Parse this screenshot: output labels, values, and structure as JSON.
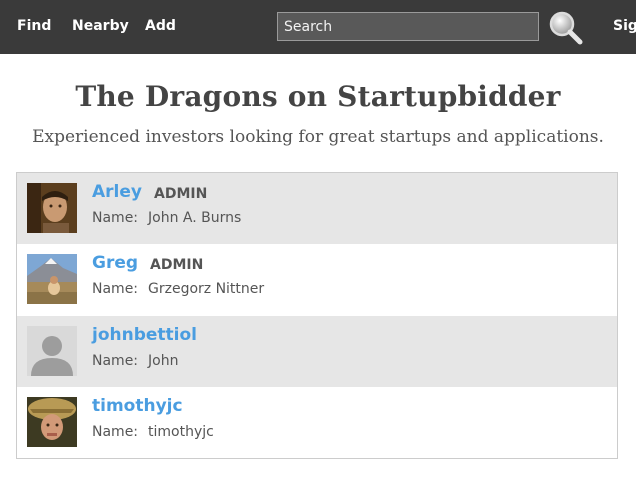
{
  "nav": {
    "links": [
      "Find",
      "Nearby",
      "Add"
    ],
    "search_placeholder": "Search",
    "signin_label": "Sig"
  },
  "page": {
    "title": "The Dragons on Startupbidder",
    "subtitle": "Experienced investors looking for great startups and applications."
  },
  "users": [
    {
      "username": "Arley",
      "role": "ADMIN",
      "name_label": "Name:",
      "name": "John A. Burns"
    },
    {
      "username": "Greg",
      "role": "ADMIN",
      "name_label": "Name:",
      "name": "Grzegorz Nittner"
    },
    {
      "username": "johnbettiol",
      "role": "",
      "name_label": "Name:",
      "name": "John"
    },
    {
      "username": "timothyjc",
      "role": "",
      "name_label": "Name:",
      "name": "timothyjc"
    }
  ],
  "colors": {
    "navbar": "#3a3a3a",
    "link": "#4a9de0",
    "row_shade": "#e6e6e6"
  },
  "icons": {
    "search": "magnifier-icon"
  }
}
